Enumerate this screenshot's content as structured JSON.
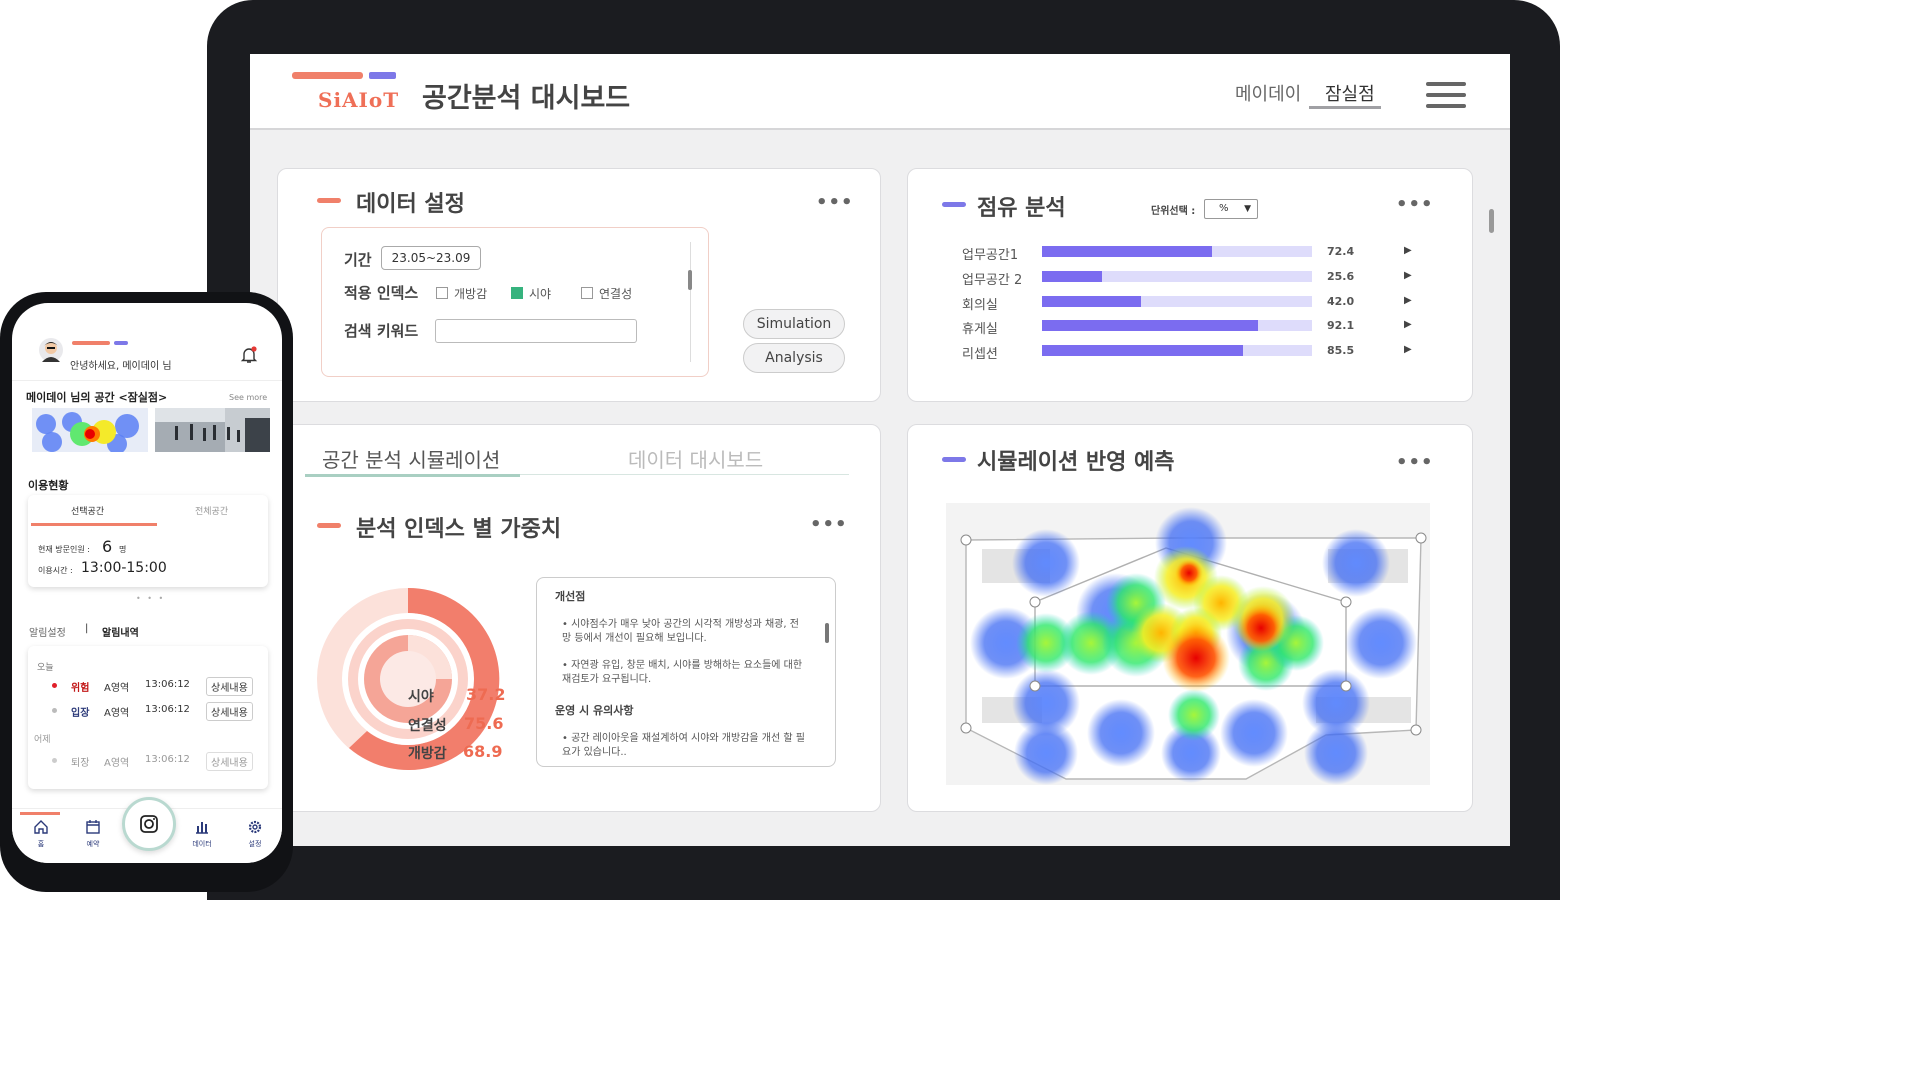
{
  "header": {
    "logo_text": "SiAIoT",
    "title": "공간분석 대시보드",
    "store_primary": "메이데이",
    "store_selected": "잠실점"
  },
  "data_settings": {
    "title": "데이터 설정",
    "period_label": "기간",
    "period_value": "23.05~23.09",
    "index_label": "적용 인덱스",
    "checkboxes": [
      {
        "label": "개방감",
        "checked": false
      },
      {
        "label": "시야",
        "checked": true
      },
      {
        "label": "연결성",
        "checked": false
      }
    ],
    "keyword_label": "검색 키워드",
    "keyword_value": "",
    "buttons": [
      "Simulation",
      "Analysis"
    ]
  },
  "occupancy": {
    "title": "점유 분석",
    "unit_label": "단위선택 :",
    "unit_value": "%",
    "rows": [
      {
        "label": "업무공간1",
        "value": 72.4,
        "display": "72.4"
      },
      {
        "label": "업무공간 2",
        "value": 25.6,
        "display": "25.6"
      },
      {
        "label": "회의실",
        "value": 42.0,
        "display": "42.0"
      },
      {
        "label": "휴게실",
        "value": 92.1,
        "display": "92.1"
      },
      {
        "label": "리셉션",
        "value": 85.5,
        "display": "85.5"
      }
    ]
  },
  "tabs": {
    "items": [
      "공간 분석 시뮬레이션",
      "데이터 대시보드"
    ],
    "active": 0
  },
  "weights": {
    "title": "분석 인덱스 별 가중치",
    "items": [
      {
        "label": "시야",
        "value": "37.2"
      },
      {
        "label": "연결성",
        "value": "75.6"
      },
      {
        "label": "개방감",
        "value": "68.9"
      }
    ],
    "notes_title_1": "개선점",
    "note_1": "• 시야점수가 매우 낮아 공간의 시각적 개방성과 채광, 전망 등에서 개선이 필요해 보입니다.",
    "note_2": "• 자연광 유입, 창문 배치, 시야를 방해하는 요소들에 대한 재검토가 요구됩니다.",
    "notes_title_2": "운영 시 유의사항",
    "note_3": "• 공간 레이아웃을 재설계하여 시야와 개방감을 개선 할 필요가 있습니다.."
  },
  "prediction": {
    "title": "시뮬레이션 반영 예측"
  },
  "phone": {
    "greeting": "안녕하세요, 메이데이 님",
    "space_title": "메이데이 님의 공간 <잠실점>",
    "see_more": "See more",
    "usage_title": "이용현황",
    "usage_tabs": [
      "선택공간",
      "전체공간"
    ],
    "visitors_label": "현재 방문인원 :",
    "visitors_value": "6",
    "visitors_unit": "명",
    "time_label": "이용시간 :",
    "time_value": "13:00-15:00",
    "alert_setting": "알림설정",
    "alert_separator": "|",
    "alert_history": "알림내역",
    "today_label": "오늘",
    "yesterday_label": "어제",
    "alerts_today": [
      {
        "type": "위험",
        "area": "A영역",
        "time": "13:06:12",
        "action": "상세내용"
      },
      {
        "type": "입장",
        "area": "A영역",
        "time": "13:06:12",
        "action": "상세내용"
      }
    ],
    "alerts_yesterday": [
      {
        "type": "퇴장",
        "area": "A영역",
        "time": "13:06:12",
        "action": "상세내용"
      }
    ],
    "nav": [
      "홈",
      "예약",
      "데이터",
      "설정"
    ]
  },
  "colors": {
    "accent_coral": "#f0806a",
    "accent_purple": "#7d78e8",
    "bar_fill": "#7b6cf0"
  },
  "icons": [
    "menu-icon",
    "bell-icon",
    "home-icon",
    "calendar-icon",
    "camera-icon",
    "chart-icon",
    "gear-icon"
  ]
}
